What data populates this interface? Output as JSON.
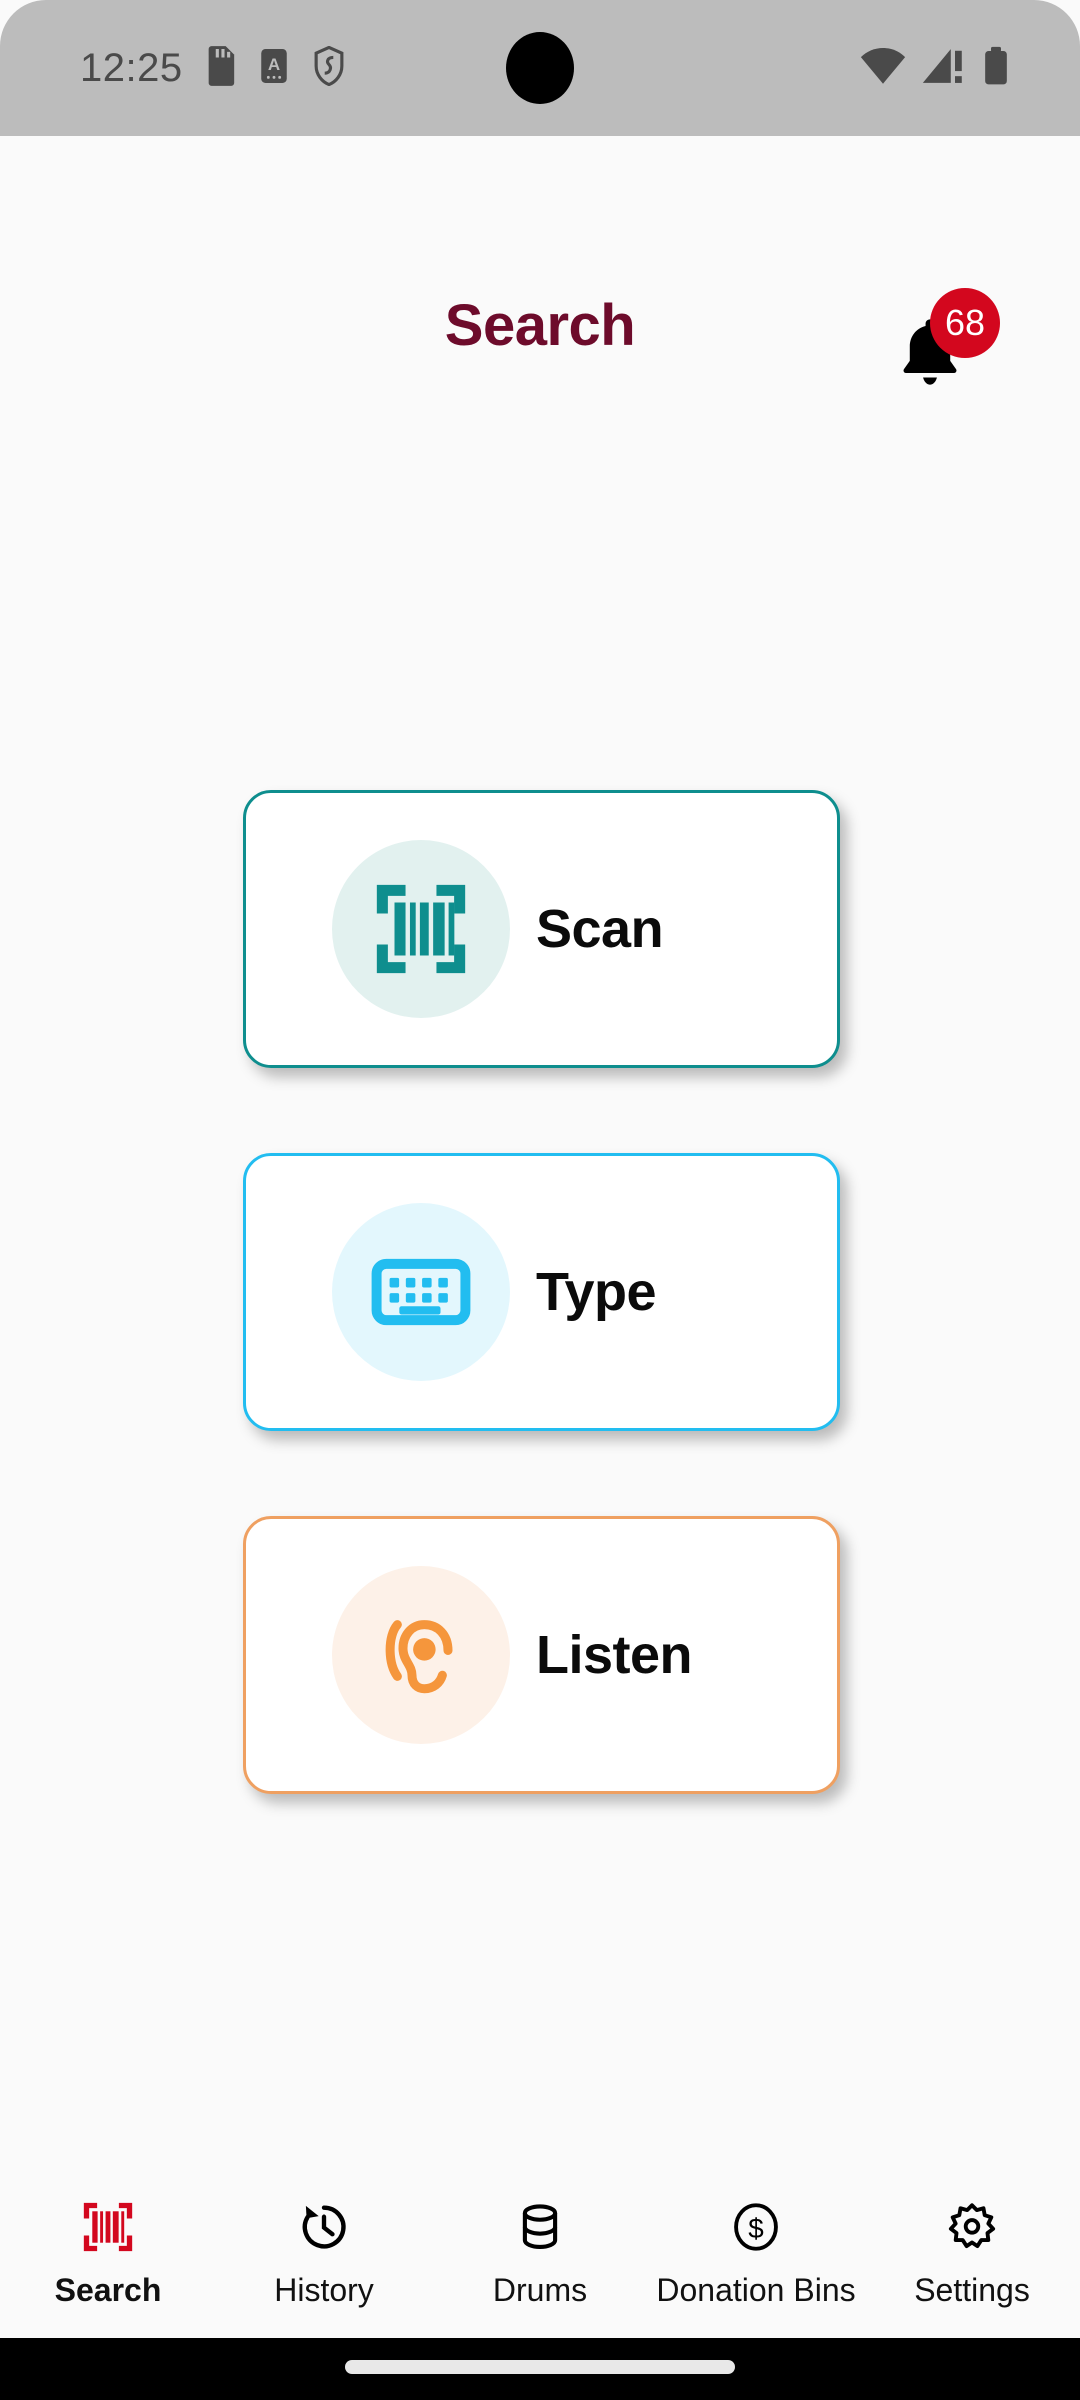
{
  "status_bar": {
    "time": "12:25",
    "left_icons": [
      "sd-card-icon",
      "auto-rotate-a-icon",
      "shield-icon"
    ],
    "right_icons": [
      "wifi-icon",
      "cellular-signal-warning-icon",
      "battery-icon"
    ],
    "background_color": "#BCBCBC"
  },
  "header": {
    "title": "Search",
    "title_color": "#6D0B2B",
    "notification_icon": "bell-icon",
    "notification_count": "68",
    "badge_color": "#D3071E"
  },
  "actions": [
    {
      "label": "Scan",
      "icon": "barcode-scan-icon",
      "border_color": "#0E8E8E",
      "icon_color": "#0E8E8E",
      "circle_color": "#E2F1EF"
    },
    {
      "label": "Type",
      "icon": "keyboard-icon",
      "border_color": "#22BDF0",
      "icon_color": "#22BDF0",
      "circle_color": "#E3F7FD"
    },
    {
      "label": "Listen",
      "icon": "ear-hearing-icon",
      "border_color": "#EFA061",
      "icon_color": "#F5963C",
      "circle_color": "#FDF1E8"
    }
  ],
  "bottom_nav": {
    "active_color": "#D3071E",
    "items": [
      {
        "label": "Search",
        "icon": "barcode-scan-icon",
        "active": true
      },
      {
        "label": "History",
        "icon": "history-clock-icon",
        "active": false
      },
      {
        "label": "Drums",
        "icon": "database-drum-icon",
        "active": false
      },
      {
        "label": "Donation Bins",
        "icon": "dollar-circle-icon",
        "active": false
      },
      {
        "label": "Settings",
        "icon": "gear-icon",
        "active": false
      }
    ]
  }
}
